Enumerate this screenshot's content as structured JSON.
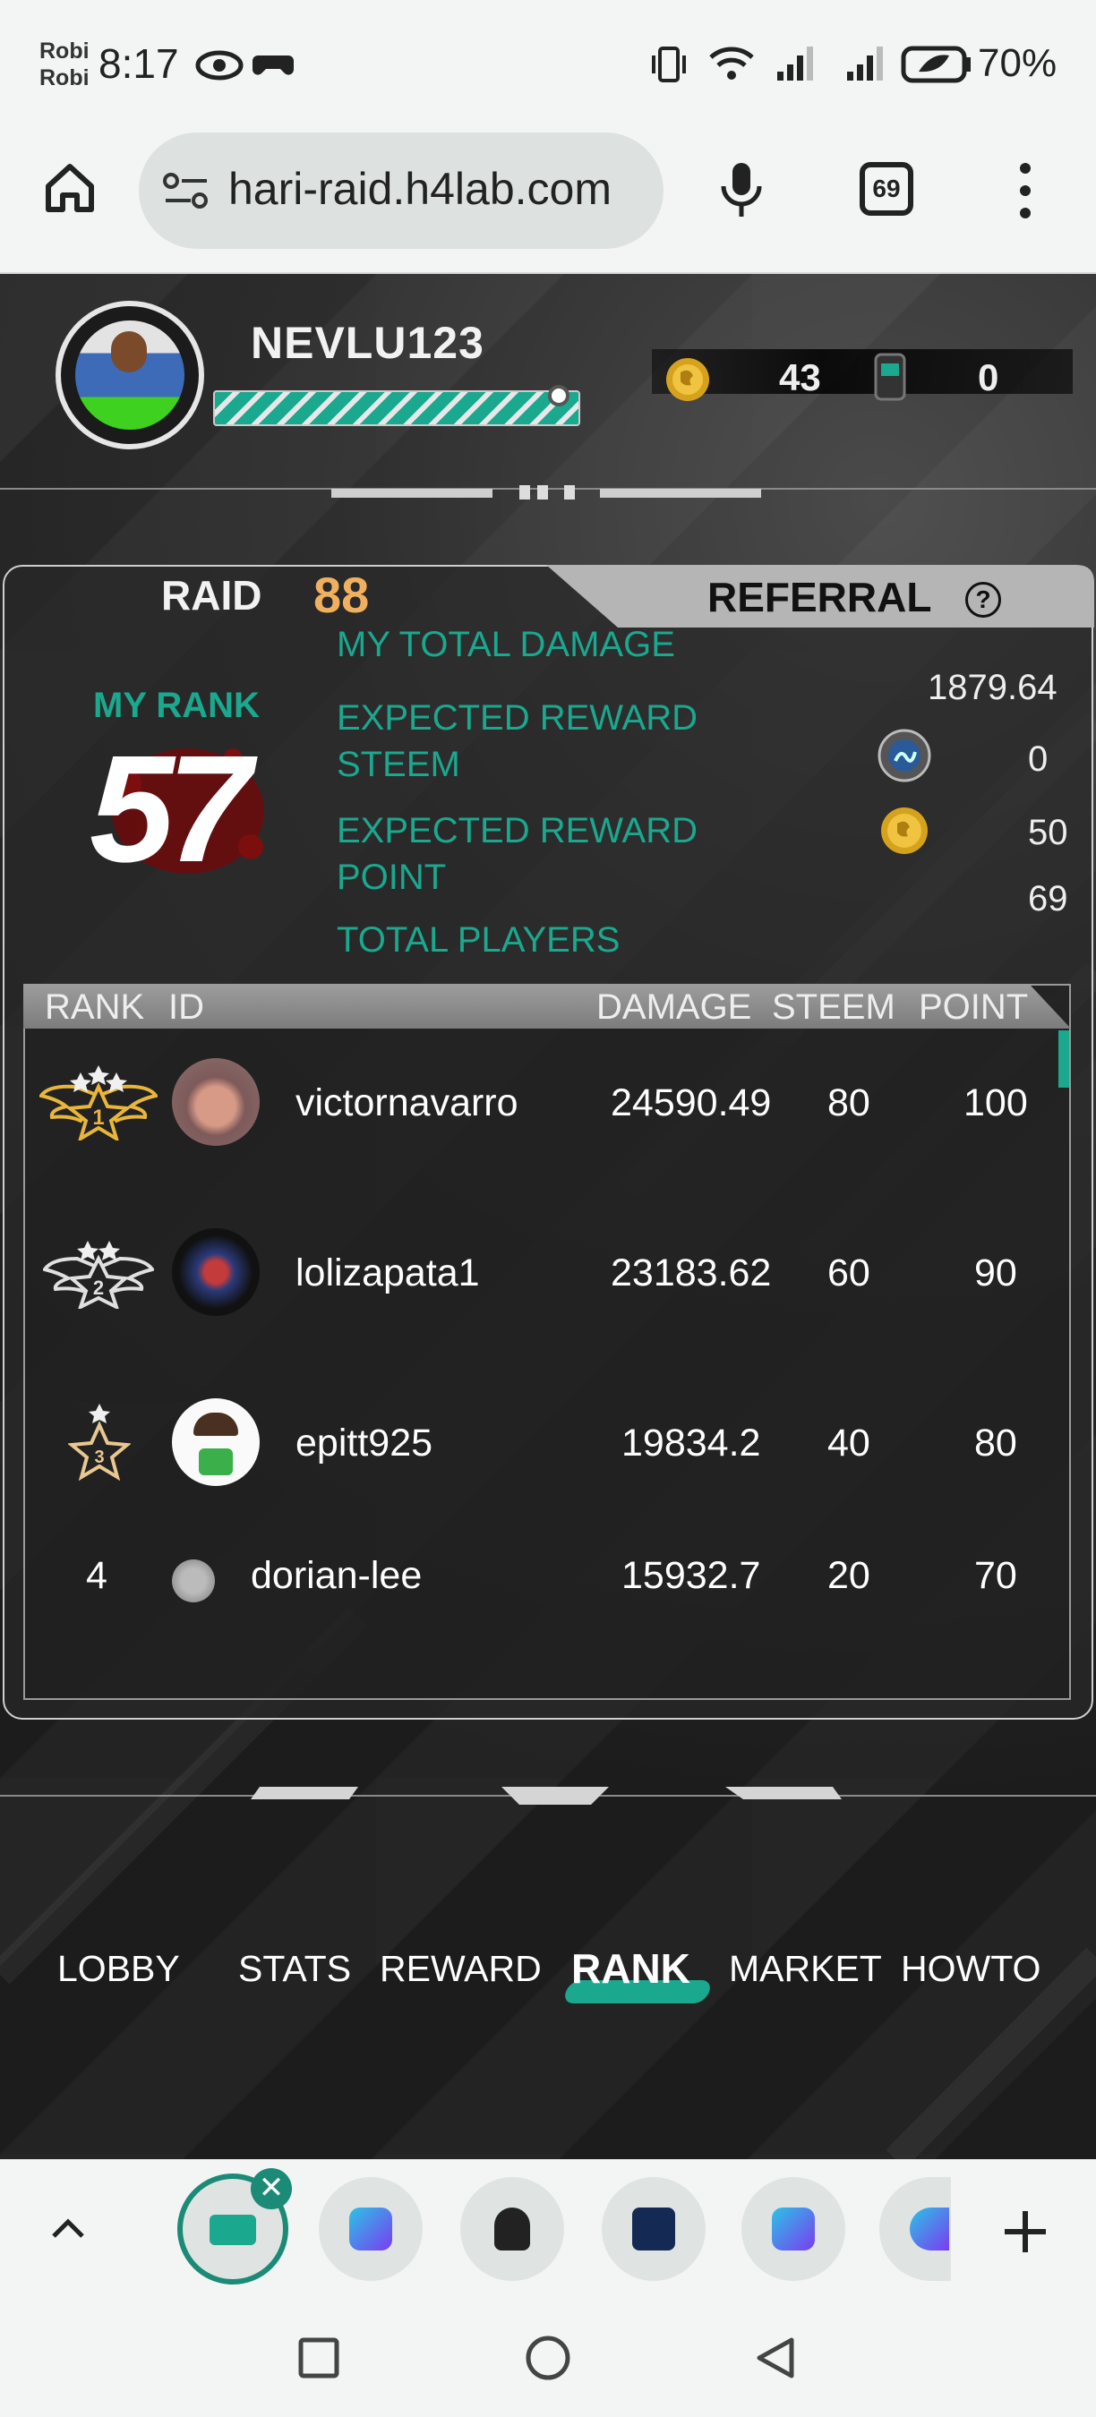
{
  "status": {
    "carrier_line1": "Robi",
    "carrier_line2": "Robi",
    "time": "8:17",
    "battery": "70%"
  },
  "browser": {
    "url": "hari-raid.h4lab.com",
    "tab_count": "69"
  },
  "player": {
    "name": "NEVLU123",
    "coins": "43",
    "tickets": "0"
  },
  "raid": {
    "raid_label": "RAID",
    "raid_number": "88",
    "referral_label": "REFERRAL",
    "referral_help": "?",
    "my_rank_label": "MY RANK",
    "my_rank_value": "57",
    "total_damage_label": "MY TOTAL DAMAGE",
    "total_damage_value": "1879.64",
    "reward_steem_label_1": "EXPECTED REWARD",
    "reward_steem_label_2": "STEEM",
    "reward_steem_value": "0",
    "reward_point_label_1": "EXPECTED REWARD",
    "reward_point_label_2": "POINT",
    "reward_point_value": "50",
    "total_players_label": "TOTAL PLAYERS",
    "total_players_value": "69"
  },
  "table": {
    "headers": [
      "RANK",
      "ID",
      "DAMAGE",
      "STEEM",
      "POINT"
    ],
    "rows": [
      {
        "rank": "1",
        "id": "victornavarro",
        "damage": "24590.49",
        "steem": "80",
        "point": "100"
      },
      {
        "rank": "2",
        "id": "lolizapata1",
        "damage": "23183.62",
        "steem": "60",
        "point": "90"
      },
      {
        "rank": "3",
        "id": "epitt925",
        "damage": "19834.2",
        "steem": "40",
        "point": "80"
      },
      {
        "rank": "4",
        "id": "dorian-lee",
        "damage": "15932.7",
        "steem": "20",
        "point": "70"
      }
    ]
  },
  "nav_tabs": [
    "LOBBY",
    "STATS",
    "REWARD",
    "RANK",
    "MARKET",
    "HOWTO"
  ],
  "active_tab": "RANK",
  "colors": {
    "accent_teal": "#1aa88f",
    "raid_number_orange": "#f0b060",
    "rank_red": "#8b0f0f"
  }
}
